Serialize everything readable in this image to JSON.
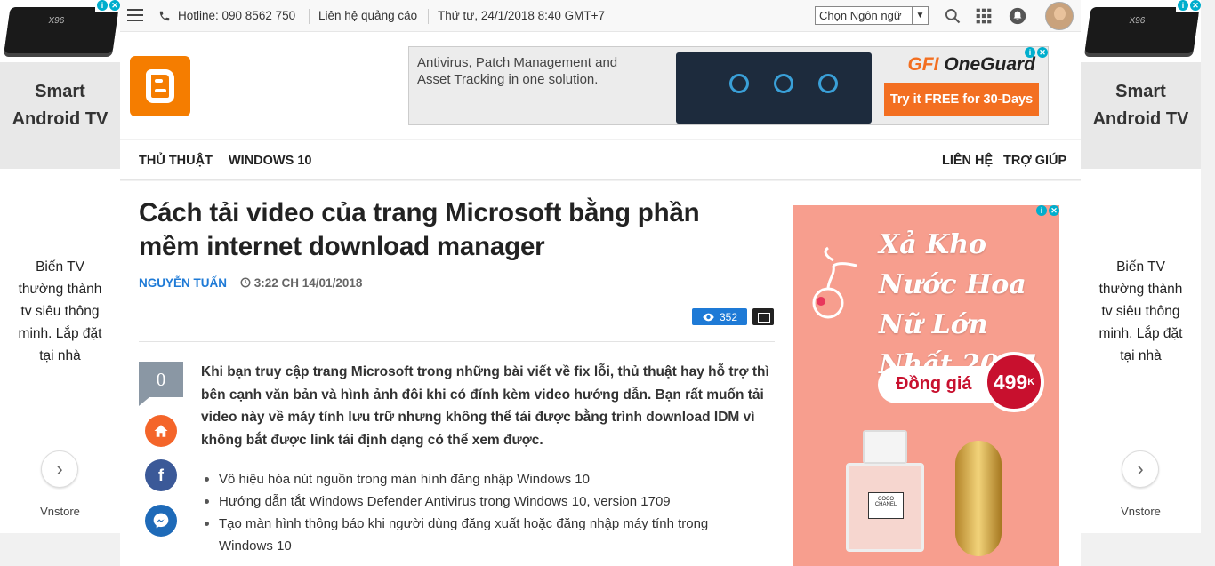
{
  "topbar": {
    "hotline": "Hotline: 090 8562 750",
    "ads_contact": "Liên hệ quảng cáo",
    "datetime": "Thứ tư, 24/1/2018 8:40 GMT+7",
    "language_select": "Chọn Ngôn ngữ"
  },
  "side_ad": {
    "title": "Smart Android TV",
    "description": "Biến TV thường thành tv siêu thông minh. Lắp đặt tại nhà",
    "brand": "Vnstore",
    "product_label": "X96"
  },
  "banner_ad": {
    "text": "Antivirus, Patch Management and Asset Tracking in one solution.",
    "brand_a": "GFI",
    "brand_b": "OneGuard",
    "cta": "Try it FREE for 30-Days"
  },
  "nav": {
    "left": [
      "THỦ THUẬT",
      "WINDOWS 10"
    ],
    "right": [
      "LIÊN HỆ",
      "TRỢ GIÚP"
    ]
  },
  "post": {
    "title": "Cách tải video của trang Microsoft bằng phần mềm internet download manager",
    "author": "NGUYỄN TUẤN",
    "date": "3:22 CH 14/01/2018",
    "views": "352",
    "comments": "0",
    "lead": "Khi bạn truy cập trang Microsoft trong những bài viết về fix lỗi, thủ thuật hay hỗ trợ thì bên cạnh văn bản và hình ảnh đôi khi có đính kèm video hướng dẫn. Bạn rất muốn tải video này về máy tính lưu trữ nhưng không thể tải được bằng trình download IDM vì không bắt được link tải định dạng có thể xem được.",
    "related": [
      "Vô hiệu hóa nút nguồn trong màn hình đăng nhập Windows 10",
      "Hướng dẫn tắt Windows Defender Antivirus trong Windows 10, version 1709",
      "Tạo màn hình thông báo khi người dùng đăng xuất hoặc đăng nhập máy tính trong Windows 10"
    ]
  },
  "right_ad": {
    "headline": "Xả Kho Nước Hoa Nữ Lớn Nhất 2017",
    "price_label": "Đồng giá",
    "price": "499",
    "price_unit": "K",
    "bottle_label": "COCO CHANEL"
  },
  "colors": {
    "accent_blue": "#1e7ad6",
    "blogger_orange": "#f57d00",
    "cta_orange": "#f36f21",
    "ad_pink": "#f79e8e",
    "price_red": "#c8102e"
  }
}
